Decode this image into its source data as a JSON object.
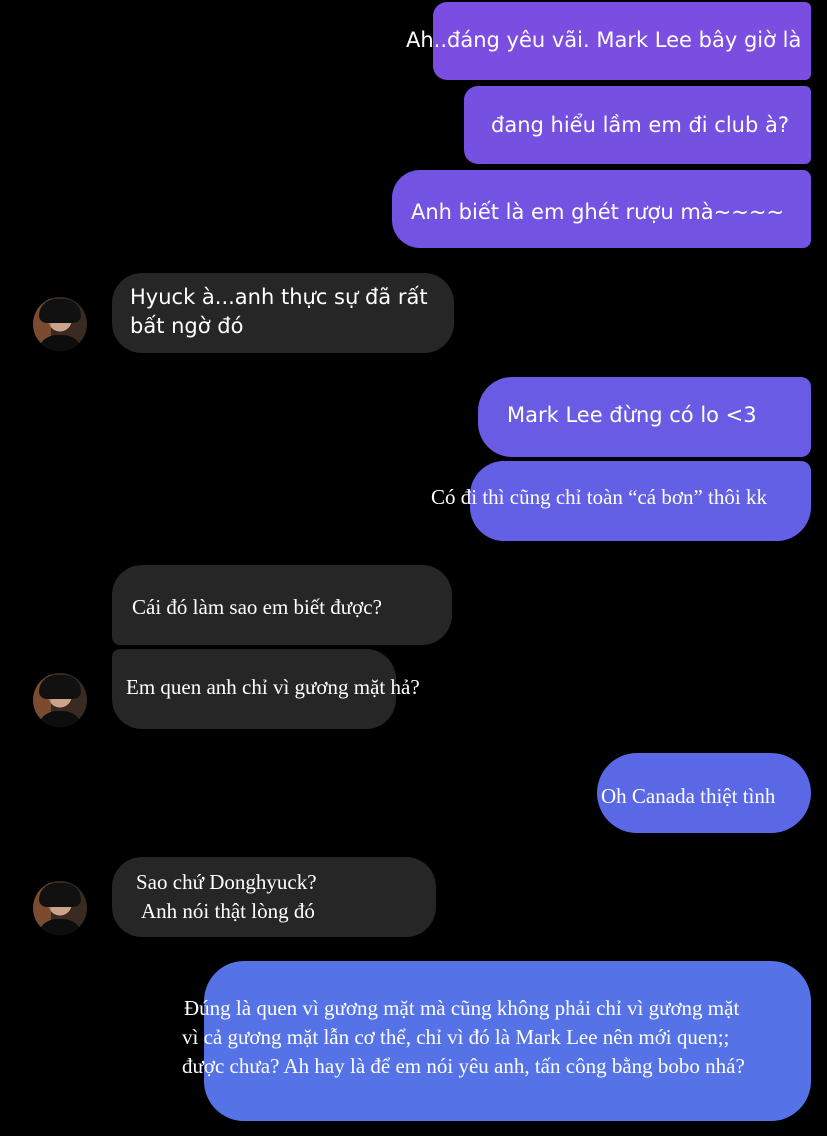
{
  "colors": {
    "sent_purple": "#7a4fe0",
    "sent_blue": "#5e6ee6",
    "received": "#262626",
    "background": "#000000"
  },
  "messages": {
    "m1": "Ah..đáng yêu vãi. Mark Lee bây giờ là",
    "m2": "đang hiểu lầm em đi club à?",
    "m3": "Anh biết là em ghét rượu mà~~~~",
    "m4_l1": "Hyuck à...anh thực sự đã rất",
    "m4_l2": "bất ngờ đó",
    "m5": "Mark Lee đừng có lo <3",
    "m6": "Có đi thì cũng chỉ toàn “cá bơn” thôi kk",
    "m7": "Cái đó làm sao em biết được?",
    "m8": "Em quen anh chỉ vì gương mặt hả?",
    "m9": "Oh Canada thiệt tình",
    "m10_l1": "Sao chứ Donghyuck?",
    "m10_l2": "Anh nói thật lòng đó",
    "m11_l1": "Đúng là quen vì gương mặt mà cũng không phải chỉ vì gương mặt",
    "m11_l2": "vì cả gương mặt lẫn cơ thể, chỉ vì đó là Mark Lee nên mới quen;;",
    "m11_l3": "được chưa? Ah hay là để em nói yêu anh, tấn công bằng bobo nhá?"
  }
}
